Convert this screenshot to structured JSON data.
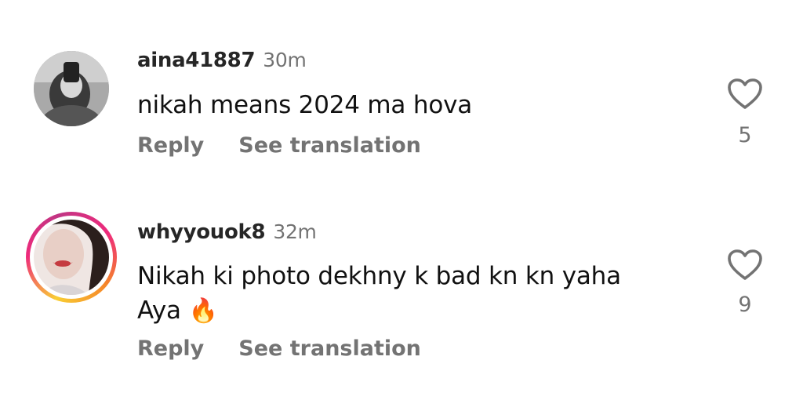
{
  "comments": [
    {
      "username": "aina41887",
      "time": "30m",
      "text": "nikah means 2024 ma hova",
      "reply_label": "Reply",
      "translate_label": "See translation",
      "likes": "5",
      "has_story_ring": false
    },
    {
      "username": "whyyouok8",
      "time": "32m",
      "text_line1": "Nikah ki photo dekhny k bad kn kn yaha",
      "text_line2": "Aya",
      "emoji": "🔥",
      "reply_label": "Reply",
      "translate_label": "See translation",
      "likes": "9",
      "has_story_ring": true
    }
  ],
  "icons": {
    "like": "heart-outline-icon"
  },
  "colors": {
    "secondary_text": "#737373",
    "story_ring_start": "#f9ce34",
    "story_ring_end": "#ee2a7b"
  }
}
